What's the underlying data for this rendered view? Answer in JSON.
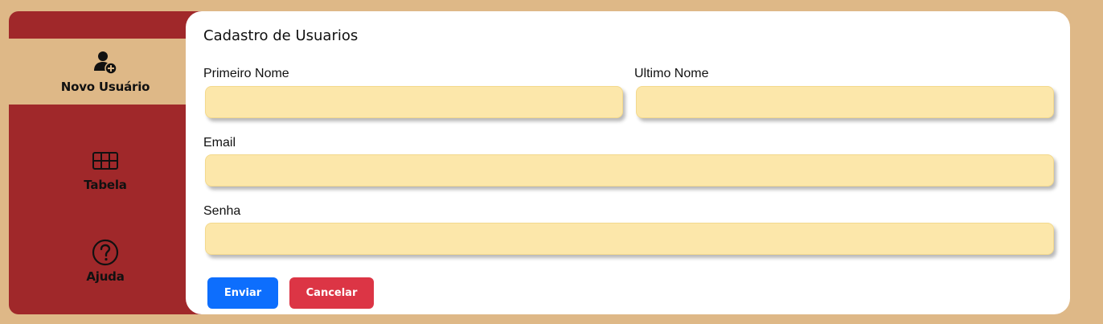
{
  "sidebar": {
    "items": [
      {
        "label": "Novo Usuário",
        "icon": "user-plus-icon",
        "active": true
      },
      {
        "label": "Tabela",
        "icon": "table-icon",
        "active": false
      },
      {
        "label": "Ajuda",
        "icon": "question-circle-icon",
        "active": false
      }
    ]
  },
  "form": {
    "title": "Cadastro de Usuarios",
    "first_name": {
      "label": "Primeiro Nome",
      "value": "",
      "placeholder": ""
    },
    "last_name": {
      "label": "Ultimo Nome",
      "value": "",
      "placeholder": ""
    },
    "email": {
      "label": "Email",
      "value": "",
      "placeholder": ""
    },
    "password": {
      "label": "Senha",
      "value": "",
      "placeholder": ""
    },
    "submit_label": "Enviar",
    "cancel_label": "Cancelar"
  },
  "colors": {
    "background": "#deb887",
    "sidebar": "#a0282a",
    "input_fill": "#fce7aa",
    "primary": "#0d6efd",
    "danger": "#dc3545"
  }
}
